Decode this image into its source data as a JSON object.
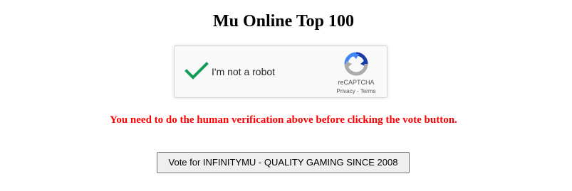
{
  "page": {
    "title": "Mu Online Top 100"
  },
  "captcha": {
    "state": "checked",
    "label": "I'm not a robot",
    "brand": "reCAPTCHA",
    "privacy_link": "Privacy",
    "separator": " - ",
    "terms_link": "Terms",
    "check_color": "#0f9d58",
    "icons": [
      "checkmark-icon",
      "recaptcha-logo-icon"
    ]
  },
  "warning": {
    "text": "You need to do the human verification above before clicking the vote button.",
    "color": "#ff0000"
  },
  "vote_button": {
    "label": "Vote for INFINITYMU - QUALITY GAMING SINCE 2008"
  }
}
